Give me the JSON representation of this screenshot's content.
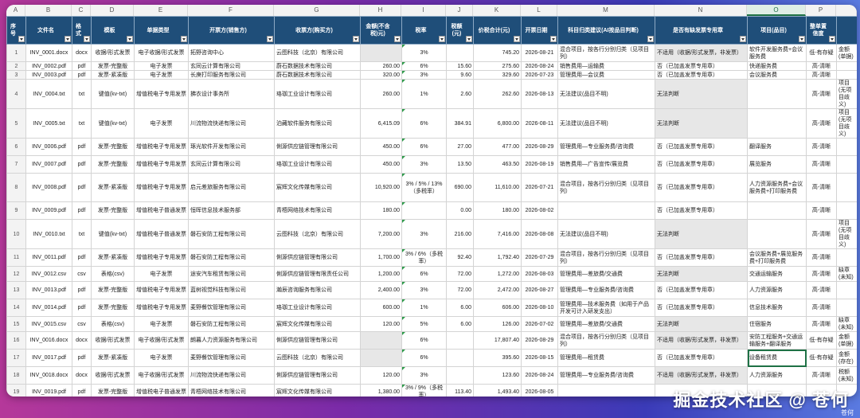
{
  "col_letters": [
    "A",
    "B",
    "C",
    "D",
    "E",
    "F",
    "G",
    "H",
    "I",
    "J",
    "K",
    "L",
    "M",
    "N",
    "O",
    "P"
  ],
  "active_col": "O",
  "headers": [
    "序号",
    "文件名",
    "格式",
    "模板",
    "单据类型",
    "开票方(销售方)",
    "收票方(购买方)",
    "金额(不含税)元)",
    "税率",
    "税额(元)",
    "价税合计(元)",
    "开票日期",
    "科目归类建议(AI按品目判断)",
    "是否有缺发票专用章",
    "项目(品目)",
    "整单置信度"
  ],
  "rows": [
    {
      "n": "1",
      "file": "INV_0001.docx",
      "fmt": "docx",
      "tpl": "收据/形式发票",
      "type": "电子收据/形式发票",
      "seller": "拓野咨询中心",
      "buyer": "云图科技（北京）有限公司",
      "amt": "",
      "rate": "3%",
      "tax": "",
      "total": "745.20",
      "date": "2026-08-21",
      "cat": "混合项目，按各行分别归类（见项目列）",
      "seal": "不适用（收据/形式发票，非发票）",
      "item": "软件开发服务费+会议服务费",
      "conf": "低-有存疑",
      "extra": "金额(单据)"
    },
    {
      "n": "2",
      "file": "INV_0002.pdf",
      "fmt": "pdf",
      "tpl": "发票-完整版",
      "type": "电子发票",
      "seller": "玄同云计算有限公司",
      "buyer": "蔚石数据技术有限公司",
      "amt": "260.00",
      "rate": "6%",
      "tax": "15.60",
      "total": "275.60",
      "date": "2026-08-24",
      "cat": "销售费用—运输费",
      "seal": "否（已加盖发票专用章）",
      "item": "快递服务费",
      "conf": "高-清晰",
      "extra": ""
    },
    {
      "n": "3",
      "file": "INV_0003.pdf",
      "fmt": "pdf",
      "tpl": "发票-紧凑版",
      "type": "电子发票",
      "seller": "长庚打印服务有限公司",
      "buyer": "蔚石数据技术有限公司",
      "amt": "320.00",
      "rate": "3%",
      "tax": "9.60",
      "total": "329.60",
      "date": "2026-07-23",
      "cat": "管理费用—会议费",
      "seal": "否（已加盖发票专用章）",
      "item": "会议服务费",
      "conf": "高-清晰",
      "extra": ""
    },
    {
      "n": "4",
      "file": "INV_0004.txt",
      "fmt": "txt",
      "tpl": "键值(kv-txt)",
      "type": "增值税电子专用发票",
      "seller": "拂衣设计事务所",
      "buyer": "珞珈工业设计有限公司",
      "amt": "260.00",
      "rate": "1%",
      "tax": "2.60",
      "total": "262.60",
      "date": "2026-08-13",
      "cat": "无法建议(品目不明)",
      "seal": "无法判断",
      "item": "",
      "conf": "高-清晰",
      "extra": "项目(无项目歧义)"
    },
    {
      "n": "5",
      "file": "INV_0005.txt",
      "fmt": "txt",
      "tpl": "键值(kv-txt)",
      "type": "电子发票",
      "seller": "川流物流快递有限公司",
      "buyer": "泊藏软件服务有限公司",
      "amt": "6,415.09",
      "rate": "6%",
      "tax": "384.91",
      "total": "6,800.00",
      "date": "2026-08-11",
      "cat": "无法建议(品目不明)",
      "seal": "无法判断",
      "item": "",
      "conf": "高-清晰",
      "extra": "项目(无项目歧义)"
    },
    {
      "n": "6",
      "file": "INV_0006.pdf",
      "fmt": "pdf",
      "tpl": "发票-完整版",
      "type": "增值税电子专用发票",
      "seller": "琢光软件开发有限公司",
      "buyer": "俐源供应链管理有限公司",
      "amt": "450.00",
      "rate": "6%",
      "tax": "27.00",
      "total": "477.00",
      "date": "2026-08-29",
      "cat": "管理费用—专业服务费/咨询费",
      "seal": "否（已加盖发票专用章）",
      "item": "翻译服务",
      "conf": "高-清晰",
      "extra": ""
    },
    {
      "n": "7",
      "file": "INV_0007.pdf",
      "fmt": "pdf",
      "tpl": "发票-完整版",
      "type": "增值税电子专用发票",
      "seller": "玄同云计算有限公司",
      "buyer": "珞珈工业设计有限公司",
      "amt": "450.00",
      "rate": "3%",
      "tax": "13.50",
      "total": "463.50",
      "date": "2026-08-19",
      "cat": "销售费用—广告宣传/展览费",
      "seal": "否（已加盖发票专用章）",
      "item": "展览服务",
      "conf": "高-清晰",
      "extra": ""
    },
    {
      "n": "8",
      "file": "INV_0008.pdf",
      "fmt": "pdf",
      "tpl": "发票-紧凑版",
      "type": "增值税电子专用发票",
      "seller": "启元差旅服务有限公司",
      "buyer": "宸辉文化传媒有限公司",
      "amt": "10,920.00",
      "rate": "3% / 5% / 13%（多税率）",
      "tax": "690.00",
      "total": "11,610.00",
      "date": "2026-07-21",
      "cat": "混合项目，按各行分别归类（见项目列）",
      "seal": "否（已加盖发票专用章）",
      "item": "人力资源服务费+会议服务费+打印服务费",
      "conf": "高-清晰",
      "extra": ""
    },
    {
      "n": "9",
      "file": "INV_0009.pdf",
      "fmt": "pdf",
      "tpl": "发票-完整版",
      "type": "增值税电子普通发票",
      "seller": "恒晖信息技术服务部",
      "buyer": "青梧网络技术有限公司",
      "amt": "180.00",
      "rate": "",
      "tax": "0.00",
      "total": "180.00",
      "date": "2026-08-02",
      "cat": "",
      "seal": "否（已加盖发票专用章）",
      "item": "",
      "conf": "高-清晰",
      "extra": ""
    },
    {
      "n": "10",
      "file": "INV_0010.txt",
      "fmt": "txt",
      "tpl": "键值(kv-txt)",
      "type": "增值税电子普通发票",
      "seller": "磐石安防工程有限公司",
      "buyer": "云图科技（北京）有限公司",
      "amt": "7,200.00",
      "rate": "3%",
      "tax": "216.00",
      "total": "7,416.00",
      "date": "2026-08-08",
      "cat": "无法建议(品目不明)",
      "seal": "无法判断",
      "item": "",
      "conf": "高-清晰",
      "extra": "项目(无项目歧义)"
    },
    {
      "n": "11",
      "file": "INV_0011.pdf",
      "fmt": "pdf",
      "tpl": "发票-紧凑版",
      "type": "增值税电子专用发票",
      "seller": "磐石安防工程有限公司",
      "buyer": "俐源供应链管理有限公司",
      "amt": "1,700.00",
      "rate": "3% / 6%（多税率）",
      "tax": "92.40",
      "total": "1,792.40",
      "date": "2026-07-29",
      "cat": "混合项目，按各行分别归类（见项目列）",
      "seal": "否（已加盖发票专用章）",
      "item": "会议服务费+展览服务费+打印服务费",
      "conf": "高-清晰",
      "extra": ""
    },
    {
      "n": "12",
      "file": "INV_0012.csv",
      "fmt": "csv",
      "tpl": "表格(csv)",
      "type": "电子发票",
      "seller": "途安汽车租赁有限公司",
      "buyer": "俐源供应链管理有限责任公司",
      "amt": "1,200.00",
      "rate": "6%",
      "tax": "72.00",
      "total": "1,272.00",
      "date": "2026-08-03",
      "cat": "管理费用—差旅费/交通费",
      "seal": "无法判断",
      "item": "交通运输服务",
      "conf": "高-清晰",
      "extra": "缺章(未知)"
    },
    {
      "n": "13",
      "file": "INV_0013.pdf",
      "fmt": "pdf",
      "tpl": "发票-完整版",
      "type": "增值税电子专用发票",
      "seller": "蓝树视觉科技有限公司",
      "buyer": "瀚辰咨询服务有限公司",
      "amt": "2,400.00",
      "rate": "3%",
      "tax": "72.00",
      "total": "2,472.00",
      "date": "2026-08-27",
      "cat": "管理费用—专业服务费/咨询费",
      "seal": "否（已加盖发票专用章）",
      "item": "人力资源服务",
      "conf": "高-清晰",
      "extra": ""
    },
    {
      "n": "14",
      "file": "INV_0014.pdf",
      "fmt": "pdf",
      "tpl": "发票-完整版",
      "type": "增值税电子专用发票",
      "seller": "麦野餐饮管理有限公司",
      "buyer": "珞珈工业设计有限公司",
      "amt": "600.00",
      "rate": "1%",
      "tax": "6.00",
      "total": "606.00",
      "date": "2026-08-10",
      "cat": "管理费用—技术服务费（如用于产品开发可计入研发支出）",
      "seal": "否（已加盖发票专用章）",
      "item": "信息技术服务",
      "conf": "高-清晰",
      "extra": ""
    },
    {
      "n": "15",
      "file": "INV_0015.csv",
      "fmt": "csv",
      "tpl": "表格(csv)",
      "type": "电子发票",
      "seller": "磐石安防工程有限公司",
      "buyer": "宸辉文化传媒有限公司",
      "amt": "120.00",
      "rate": "5%",
      "tax": "6.00",
      "total": "126.00",
      "date": "2026-07-02",
      "cat": "管理费用—差旅费/交通费",
      "seal": "无法判断",
      "item": "住宿服务",
      "conf": "高-清晰",
      "extra": "缺章(未知)"
    },
    {
      "n": "16",
      "file": "INV_0016.docx",
      "fmt": "docx",
      "tpl": "收据/形式发票",
      "type": "电子收据/形式发票",
      "seller": "朗暮人力资源服务有限公司",
      "buyer": "俐源供应链管理有限公司",
      "amt": "",
      "rate": "6%",
      "tax": "",
      "total": "17,807.40",
      "date": "2026-08-29",
      "cat": "混合项目，按各行分别归类（见项目列）",
      "seal": "不适用（收据/形式发票，非发票）",
      "item": "安防工程服务+交通运输服务+翻译服务",
      "conf": "低-有存疑",
      "extra": "金额(单据)"
    },
    {
      "n": "17",
      "file": "INV_0017.pdf",
      "fmt": "pdf",
      "tpl": "发票-紧凑版",
      "type": "电子发票",
      "seller": "麦野餐饮管理有限公司",
      "buyer": "云图科技（北京）有限公司",
      "amt": "",
      "rate": "6%",
      "tax": "",
      "total": "395.60",
      "date": "2026-08-15",
      "cat": "管理费用—租赁费",
      "seal": "否（已加盖发票专用章）",
      "item": "设备租赁费",
      "conf": "低-有存疑",
      "extra": "金额(存在)"
    },
    {
      "n": "18",
      "file": "INV_0018.docx",
      "fmt": "docx",
      "tpl": "收据/形式发票",
      "type": "电子收据/形式发票",
      "seller": "川流物流快递有限公司",
      "buyer": "俐源供应链管理有限公司",
      "amt": "120.00",
      "rate": "3%",
      "tax": "",
      "total": "123.60",
      "date": "2026-08-24",
      "cat": "管理费用—专业服务费/咨询费",
      "seal": "不适用（收据/形式发票，非发票）",
      "item": "人力资源服务",
      "conf": "高-清晰",
      "extra": "税额(未知)"
    },
    {
      "n": "19",
      "file": "INV_0019.pdf",
      "fmt": "pdf",
      "tpl": "发票-完整版",
      "type": "增值税电子普通发票",
      "seller": "青梧网络技术有限公司",
      "buyer": "宸辉文化传媒有限公司",
      "amt": "1,380.00",
      "rate": "3% / 9%（多税率）",
      "tax": "113.40",
      "total": "1,493.40",
      "date": "2026-08-05",
      "cat": "",
      "seal": "",
      "item": "",
      "conf": "",
      "extra": ""
    }
  ],
  "watermark": "掘金技术社区 @ 苍何",
  "watermark_small": "苍何"
}
